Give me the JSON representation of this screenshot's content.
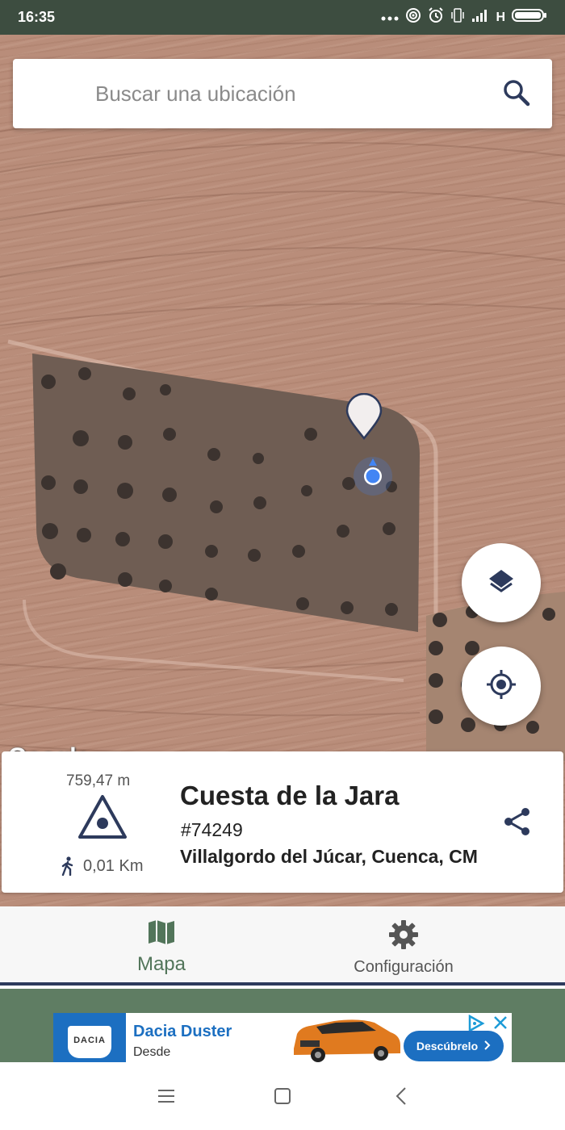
{
  "status_bar": {
    "time": "16:35",
    "network": "H",
    "icons": [
      "more-dots-icon",
      "hotspot-icon",
      "alarm-icon",
      "vibrate-icon",
      "signal-icon",
      "battery-icon"
    ]
  },
  "search": {
    "placeholder": "Buscar una ubicación",
    "icon": "search-icon"
  },
  "map": {
    "attribution": "Google",
    "map_type": "satellite",
    "colors": {
      "field": "#b98d7a",
      "olive_grove": "#6f5d53",
      "location_dot": "#4285f4"
    }
  },
  "fabs": {
    "layers_icon": "layers-icon",
    "locate_icon": "my-location-icon"
  },
  "peak_card": {
    "elevation": "759,47 m",
    "distance": "0,01 Km",
    "name": "Cuesta de la Jara",
    "id": "#74249",
    "location": "Villalgordo del Júcar, Cuenca, CM",
    "icons": [
      "peak-triangle-icon",
      "walking-icon",
      "share-icon"
    ]
  },
  "bottom_nav": {
    "items": [
      {
        "label": "Mapa",
        "icon": "map-icon",
        "active": true
      },
      {
        "label": "Configuración",
        "icon": "gear-icon",
        "active": false
      }
    ],
    "colors": {
      "active": "#52755a",
      "inactive": "#555555"
    }
  },
  "ad": {
    "brand": "DACIA",
    "title": "Dacia Duster",
    "subtitle": "Desde",
    "cta": "Descúbrelo",
    "colors": {
      "brand_blue": "#1c6fc1",
      "car": "#e07a1f"
    }
  },
  "system_nav": {
    "icons": [
      "menu-icon",
      "home-icon",
      "back-icon"
    ]
  }
}
